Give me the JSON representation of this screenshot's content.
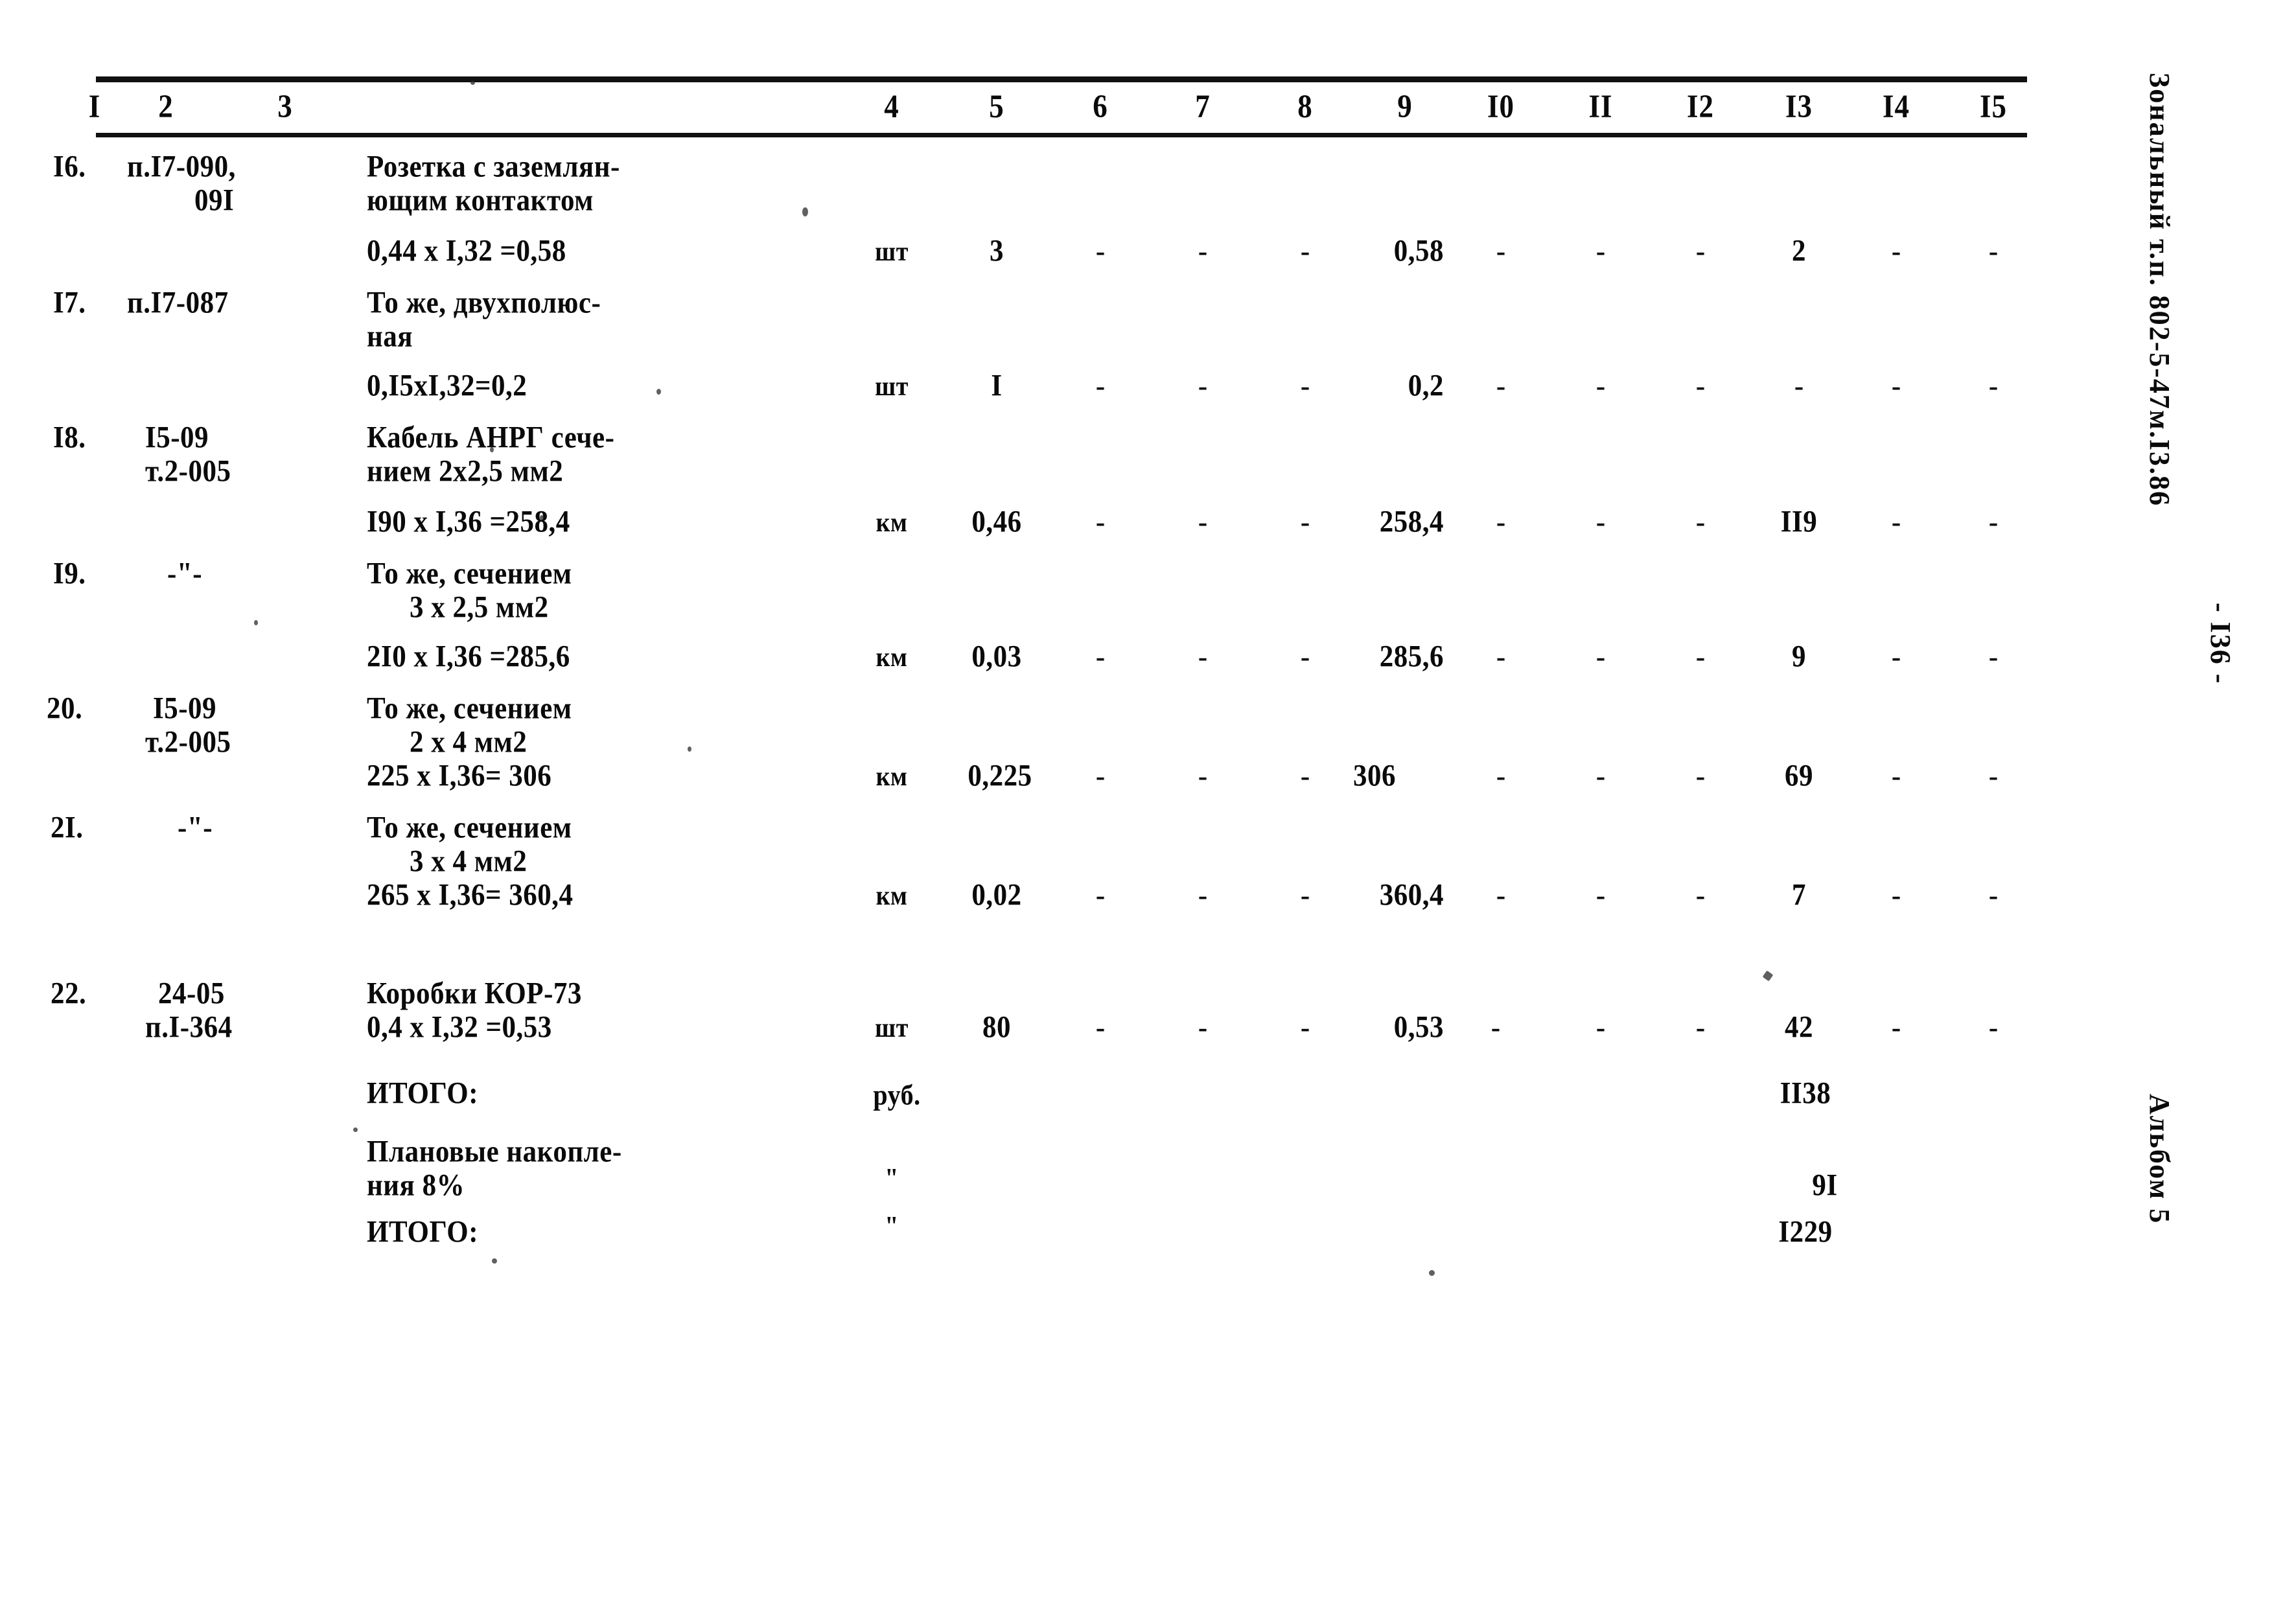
{
  "document": {
    "page_number": "- I36 -",
    "series_stamp": "Зональный т.п. 802-5-47м.I3.86",
    "album_stamp": "Альбом 5"
  },
  "table": {
    "column_headers": [
      "I",
      "2",
      "3",
      "4",
      "5",
      "6",
      "7",
      "8",
      "9",
      "I0",
      "II",
      "I2",
      "I3",
      "I4",
      "I5"
    ],
    "rows": [
      {
        "no": "I6.",
        "code_line1": "п.I7-090,",
        "code_line2": "09I",
        "desc_line1": "Розетка с заземлян-",
        "desc_line2": "ющим контактом",
        "calc": "0,44 x I,32 =0,58",
        "unit": "шт",
        "qty": "3",
        "c6": "-",
        "c7": "-",
        "c8": "-",
        "c9": "0,58",
        "c10": "-",
        "c11": "-",
        "c12": "-",
        "c13": "2",
        "c14": "-",
        "c15": "-"
      },
      {
        "no": "I7.",
        "code_line1": "п.I7-087",
        "code_line2": "",
        "desc_line1": "То же, двухполюс-",
        "desc_line2": "ная",
        "calc": "0,I5xI,32=0,2",
        "unit": "шт",
        "qty": "I",
        "c6": "-",
        "c7": "-",
        "c8": "-",
        "c9": "0,2",
        "c10": "-",
        "c11": "-",
        "c12": "-",
        "c13": "-",
        "c14": "-",
        "c15": "-"
      },
      {
        "no": "I8.",
        "code_line1": "I5-09",
        "code_line2": "т.2-005",
        "desc_line1": "Кабель АНРГ сече-",
        "desc_line2": "нием 2х2,5 мм2",
        "calc": "I90 х I,36 =258,4",
        "unit": "км",
        "qty": "0,46",
        "c6": "-",
        "c7": "-",
        "c8": "-",
        "c9": "258,4",
        "c10": "-",
        "c11": "-",
        "c12": "-",
        "c13": "II9",
        "c14": "-",
        "c15": "-"
      },
      {
        "no": "I9.",
        "code_line1": "-\"-",
        "code_line2": "",
        "desc_line1": "То же, сечением",
        "desc_line2": "3 х 2,5 мм2",
        "calc": "2I0 х I,36 =285,6",
        "unit": "км",
        "qty": "0,03",
        "c6": "-",
        "c7": "-",
        "c8": "-",
        "c9": "285,6",
        "c10": "-",
        "c11": "-",
        "c12": "-",
        "c13": "9",
        "c14": "-",
        "c15": "-"
      },
      {
        "no": "20.",
        "code_line1": "I5-09",
        "code_line2": "т.2-005",
        "desc_line1": "То же, сечением",
        "desc_line2": "2 х 4 мм2",
        "calc": "225 х I,36= 306",
        "unit": "км",
        "qty": "0,225",
        "c6": "-",
        "c7": "-",
        "c8": "-",
        "c9": "306",
        "c10": "-",
        "c11": "-",
        "c12": "-",
        "c13": "69",
        "c14": "-",
        "c15": "-"
      },
      {
        "no": "2I.",
        "code_line1": "-\"-",
        "code_line2": "",
        "desc_line1": "То же, сечением",
        "desc_line2": "3 х 4 мм2",
        "calc": "265 х I,36= 360,4",
        "unit": "км",
        "qty": "0,02",
        "c6": "-",
        "c7": "-",
        "c8": "-",
        "c9": "360,4",
        "c10": "-",
        "c11": "-",
        "c12": "-",
        "c13": "7",
        "c14": "-",
        "c15": "-"
      },
      {
        "no": "22.",
        "code_line1": "24-05",
        "code_line2": "п.I-364",
        "desc_line1": "Коробки КОР-73",
        "desc_line2": "",
        "calc": "0,4 х I,32 =0,53",
        "unit": "шт",
        "qty": "80",
        "c6": "-",
        "c7": "-",
        "c8": "-",
        "c9": "0,53",
        "c10": "-",
        "c11": "-",
        "c12": "-",
        "c13": "42",
        "c14": "-",
        "c15": "-"
      }
    ],
    "summary": [
      {
        "label_line1": "ИТОГО:",
        "label_line2": "",
        "unit": "руб.",
        "total": "II38"
      },
      {
        "label_line1": "Плановые накопле-",
        "label_line2": "ния 8%",
        "unit": "\"",
        "total": "9I"
      },
      {
        "label_line1": "ИТОГО:",
        "label_line2": "",
        "unit": "\"",
        "total": "I229"
      }
    ]
  }
}
